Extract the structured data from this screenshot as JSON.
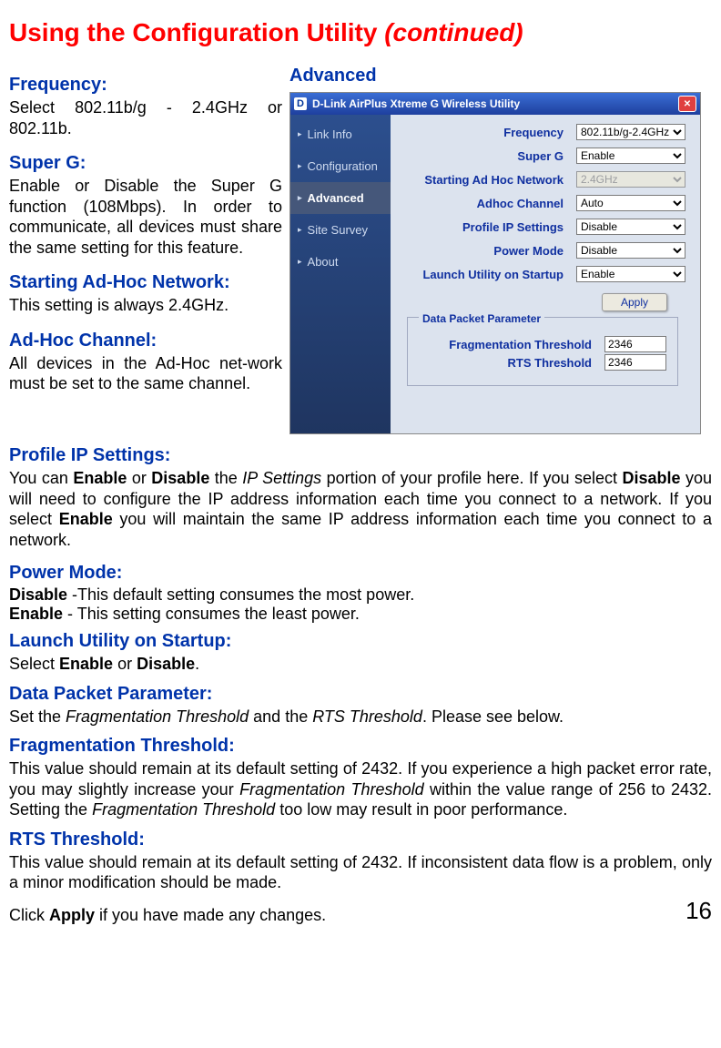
{
  "title_main": "Using the Configuration Utility ",
  "title_cont": "(continued)",
  "left": {
    "freq_h": "Frequency:",
    "freq_b": "Select 802.11b/g - 2.4GHz or 802.11b.",
    "superg_h": "Super G:",
    "superg_b": "Enable or Disable the Super G function (108Mbps). In order to communicate, all devices must share the same setting for this feature.",
    "adhocnet_h": "Starting Ad-Hoc Network:",
    "adhocnet_b": "This setting is always 2.4GHz.",
    "adhocch_h": "Ad-Hoc Channel:",
    "adhocch_b": "All devices in the Ad-Hoc net-work must be set to the same channel."
  },
  "advanced_label": "Advanced",
  "window": {
    "title": "D-Link AirPlus Xtreme G Wireless Utility",
    "nav": {
      "linkinfo": "Link Info",
      "configuration": "Configuration",
      "advanced": "Advanced",
      "sitesurvey": "Site Survey",
      "about": "About"
    },
    "fields": {
      "frequency_label": "Frequency",
      "frequency_value": "802.11b/g-2.4GHz",
      "superg_label": "Super G",
      "superg_value": "Enable",
      "startadhoc_label": "Starting Ad Hoc Network",
      "startadhoc_value": "2.4GHz",
      "adhocch_label": "Adhoc Channel",
      "adhocch_value": "Auto",
      "profileip_label": "Profile IP Settings",
      "profileip_value": "Disable",
      "powermode_label": "Power Mode",
      "powermode_value": "Disable",
      "launch_label": "Launch Utility on Startup",
      "launch_value": "Enable"
    },
    "apply": "Apply",
    "fieldset": {
      "legend": "Data Packet Parameter",
      "frag_label": "Fragmentation Threshold",
      "frag_value": "2346",
      "rts_label": "RTS Threshold",
      "rts_value": "2346"
    }
  },
  "full": {
    "profileip_h": "Profile IP Settings:",
    "profileip_b_pre": "You can ",
    "profileip_b_b1": "Enable",
    "profileip_b_mid1": " or ",
    "profileip_b_b2": "Disable",
    "profileip_b_mid2": " the ",
    "profileip_b_em": "IP Settings",
    "profileip_b_mid3": " portion of your profile  here. If you select ",
    "profileip_b_b3": "Disable",
    "profileip_b_mid4": " you will need to configure the IP address information each time you connect to a network. If you select ",
    "profileip_b_b4": "Enable",
    "profileip_b_end": " you will maintain the same IP address information each time you connect to a network.",
    "power_h": "Power Mode:",
    "power_l1_b": "Disable",
    "power_l1_r": " -This default setting consumes the most power.",
    "power_l2_b": "Enable",
    "power_l2_r": " - This setting consumes the least power.",
    "launch_h": "Launch Utility on Startup:",
    "launch_b_pre": "Select ",
    "launch_b_b1": "Enable",
    "launch_b_mid": " or ",
    "launch_b_b2": "Disable",
    "launch_b_end": ".",
    "dpp_h": "Data Packet Parameter:",
    "dpp_b_pre": "Set the ",
    "dpp_b_em1": "Fragmentation Threshold",
    "dpp_b_mid": " and the ",
    "dpp_b_em2": "RTS Threshold",
    "dpp_b_end": ". Please see below.",
    "frag_h": "Fragmentation Threshold:",
    "frag_b_pre": "This value should remain at its default setting of 2432. If you experience a high packet error rate, you may slightly increase your ",
    "frag_b_em1": "Fragmentation Threshold",
    "frag_b_mid": " within the value range of 256 to 2432. Setting the ",
    "frag_b_em2": "Fragmentation Threshold",
    "frag_b_end": " too low may result in poor performance.",
    "rts_h": "RTS Threshold:",
    "rts_b": "This value should remain at its default setting of 2432. If inconsistent data flow is a problem, only a minor modification should be made.",
    "click_pre": "Click ",
    "click_b": "Apply",
    "click_end": " if you have made any changes.",
    "page_num": "16"
  }
}
